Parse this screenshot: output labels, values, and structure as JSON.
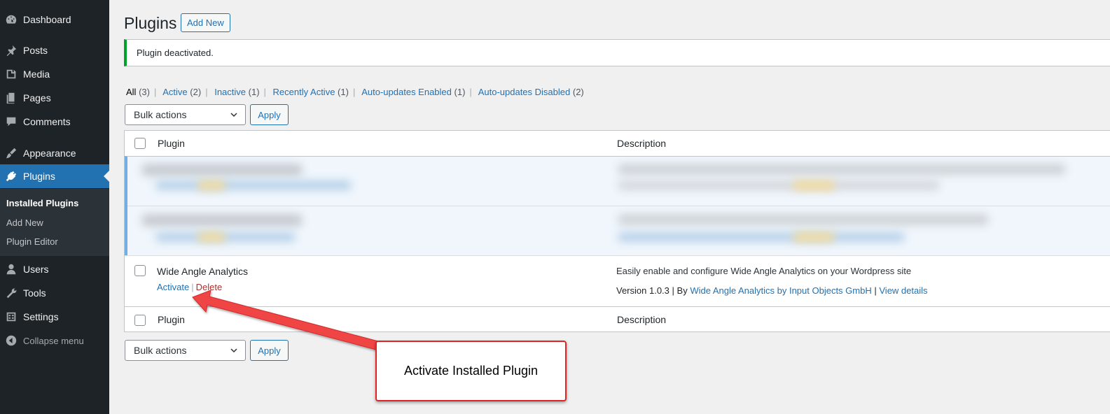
{
  "sidebar": {
    "items": [
      {
        "label": "Dashboard",
        "icon": "dashboard-icon"
      },
      {
        "label": "Posts",
        "icon": "pushpin-icon"
      },
      {
        "label": "Media",
        "icon": "media-icon"
      },
      {
        "label": "Pages",
        "icon": "pages-icon"
      },
      {
        "label": "Comments",
        "icon": "comment-icon"
      },
      {
        "label": "Appearance",
        "icon": "paintbrush-icon"
      },
      {
        "label": "Plugins",
        "icon": "plug-icon"
      },
      {
        "label": "Users",
        "icon": "user-icon"
      },
      {
        "label": "Tools",
        "icon": "wrench-icon"
      },
      {
        "label": "Settings",
        "icon": "settings-icon"
      }
    ],
    "submenu": [
      "Installed Plugins",
      "Add New",
      "Plugin Editor"
    ],
    "collapse_label": "Collapse menu"
  },
  "header": {
    "title": "Plugins",
    "add_new_label": "Add New"
  },
  "notice": {
    "text": "Plugin deactivated."
  },
  "filters": {
    "all": {
      "label": "All",
      "count": "(3)"
    },
    "active": {
      "label": "Active",
      "count": "(2)"
    },
    "inactive": {
      "label": "Inactive",
      "count": "(1)"
    },
    "recently_active": {
      "label": "Recently Active",
      "count": "(1)"
    },
    "auto_enabled": {
      "label": "Auto-updates Enabled",
      "count": "(1)"
    },
    "auto_disabled": {
      "label": "Auto-updates Disabled",
      "count": "(2)"
    }
  },
  "bulk": {
    "select_label": "Bulk actions",
    "apply_label": "Apply"
  },
  "table": {
    "col_plugin": "Plugin",
    "col_description": "Description",
    "plugin": {
      "name": "Wide Angle Analytics",
      "activate_label": "Activate",
      "delete_label": "Delete",
      "description": "Easily enable and configure Wide Angle Analytics on your Wordpress site",
      "version": "Version 1.0.3",
      "by": "By",
      "author": "Wide Angle Analytics by Input Objects GmbH",
      "view_details": "View details"
    }
  },
  "annotation": {
    "text": "Activate Installed Plugin"
  },
  "colors": {
    "sidebar_bg": "#1d2327",
    "accent": "#2271b1",
    "notice_success": "#00a32a",
    "delete": "#b32d2e",
    "annotation_red": "#e02424"
  }
}
